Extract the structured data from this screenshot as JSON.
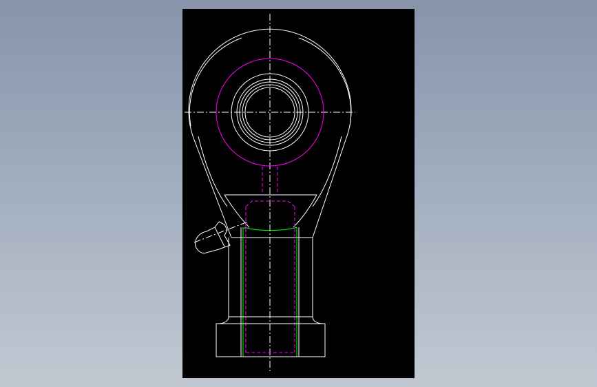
{
  "viewport": {
    "background_color": "#000000",
    "content": "cad-drawing-rod-end-bearing"
  },
  "colors": {
    "outline": "#ffffff",
    "hidden_magenta": "#ff00ff",
    "green": "#00ff00",
    "centerline": "#ffffff"
  }
}
